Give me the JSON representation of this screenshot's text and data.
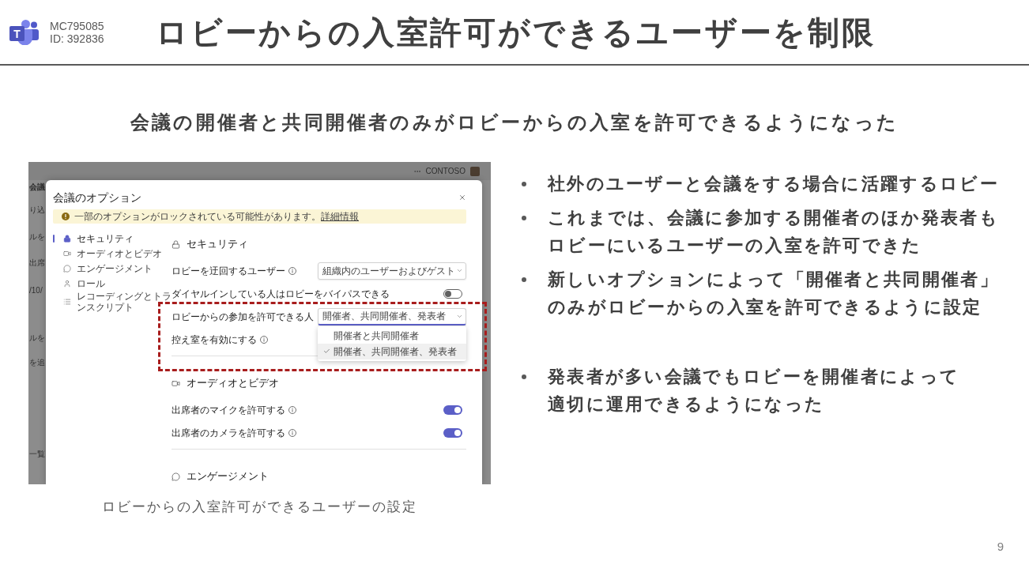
{
  "header": {
    "logo_letter": "T",
    "notice_id": "MC795085",
    "id_label": "ID: 392836",
    "title": "ロビーからの入室許可ができるユーザーを制限"
  },
  "subtitle": "会議の開催者と共同開催者のみがロビーからの入室を許可できるようになった",
  "screenshot": {
    "top_bar": {
      "account": "CONTOSO"
    },
    "background_fragments": [
      "会議",
      "り込",
      "ルを",
      "出席",
      "/10/",
      "ルを",
      "を追",
      "一覧"
    ],
    "dialog": {
      "title": "会議のオプション",
      "notice": {
        "text": "一部のオプションがロックされている可能性があります。",
        "link": "詳細情報"
      },
      "nav": [
        {
          "kind": "security",
          "label": "セキュリティ",
          "selected": true
        },
        {
          "kind": "audio-video",
          "label": "オーディオとビデオ",
          "selected": false
        },
        {
          "kind": "engagement",
          "label": "エンゲージメント",
          "selected": false
        },
        {
          "kind": "roles",
          "label": "ロール",
          "selected": false
        },
        {
          "kind": "recording",
          "label": "レコーディングとトランスクリプト",
          "selected": false
        }
      ],
      "sections": [
        {
          "kind": "security",
          "heading": "セキュリティ",
          "rows": [
            {
              "kind": "dropdown",
              "label": "ロビーを迂回するユーザー",
              "info": true,
              "value": "組織内のユーザーおよびゲスト",
              "expanded": false,
              "highlighted": false
            },
            {
              "kind": "toggle",
              "label": "ダイヤルインしている人はロビーをバイパスできる",
              "info": false,
              "on": false,
              "highlighted": false
            },
            {
              "kind": "dropdown",
              "label": "ロビーからの参加を許可できる人",
              "info": false,
              "value": "開催者、共同開催者、発表者",
              "expanded": true,
              "options": [
                {
                  "label": "開催者と共同開催者",
                  "selected": false
                },
                {
                  "label": "開催者、共同開催者、発表者",
                  "selected": true
                }
              ],
              "highlighted": true
            },
            {
              "kind": "plain",
              "label": "控え室を有効にする",
              "info": true,
              "highlighted": true
            }
          ]
        },
        {
          "kind": "audio-video",
          "heading": "オーディオとビデオ",
          "rows": [
            {
              "kind": "toggle",
              "label": "出席者のマイクを許可する",
              "info": true,
              "on": true,
              "highlighted": false
            },
            {
              "kind": "toggle",
              "label": "出席者のカメラを許可する",
              "info": true,
              "on": true,
              "highlighted": false
            }
          ]
        },
        {
          "kind": "engagement",
          "heading": "エンゲージメント"
        }
      ]
    }
  },
  "caption": "ロビーからの入室許可ができるユーザーの設定",
  "bullet_groups": [
    [
      {
        "lines": [
          "社外のユーザーと会議をする場合に活躍するロビー"
        ]
      },
      {
        "lines": [
          "これまでは、会議に参加する開催者のほか発表者も",
          "ロビーにいるユーザーの入室を許可できた"
        ]
      },
      {
        "lines": [
          "新しいオプションによって「開催者と共同開催者」",
          "のみがロビーからの入室を許可できるように設定"
        ]
      }
    ],
    [
      {
        "lines": [
          "発表者が多い会議でもロビーを開催者によって",
          "適切に運用できるようになった"
        ]
      }
    ]
  ],
  "page_number": "9"
}
